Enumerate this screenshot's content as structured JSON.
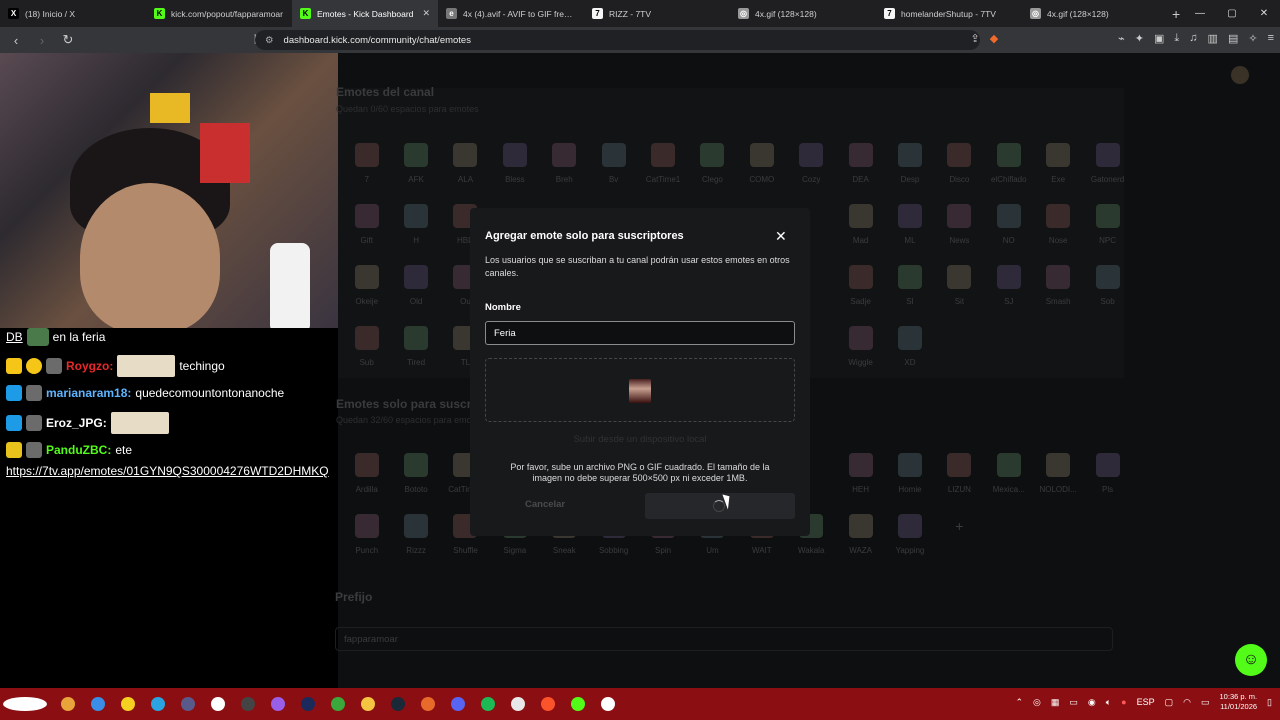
{
  "browser": {
    "tabs": [
      {
        "label": "(18) Inicio / X",
        "icon": "x-icon",
        "color": "#000000",
        "glyph": "X"
      },
      {
        "label": "kick.com/popout/fapparamoar",
        "icon": "kick-icon",
        "color": "#53fc18",
        "glyph": "K"
      },
      {
        "label": "Emotes - Kick Dashboard",
        "icon": "kick-icon",
        "color": "#53fc18",
        "glyph": "K",
        "active": true
      },
      {
        "label": "4x (4).avif - AVIF to GIF free on",
        "icon": "ezgif-icon",
        "color": "#777777",
        "glyph": "e"
      },
      {
        "label": "RIZZ - 7TV",
        "icon": "7tv-icon",
        "color": "#f5f5f5",
        "glyph": "7"
      },
      {
        "label": "4x.gif (128×128)",
        "icon": "globe-icon",
        "color": "#999999",
        "glyph": "◎"
      },
      {
        "label": "homelanderShutup - 7TV",
        "icon": "7tv-icon",
        "color": "#f5f5f5",
        "glyph": "7"
      },
      {
        "label": "4x.gif (128×128)",
        "icon": "globe-icon",
        "color": "#999999",
        "glyph": "◎"
      }
    ],
    "url": "dashboard.kick.com/community/chat/emotes"
  },
  "chat": {
    "messages": [
      {
        "user": "DB",
        "text": "en la feria",
        "user_color": "#ffffff"
      },
      {
        "user": "Roygzo:",
        "text": "techingo",
        "user_color": "#e8282b"
      },
      {
        "user": "marianaram18:",
        "text": "quedecomountontonanoche",
        "user_color": "#5fb4ff"
      },
      {
        "user": "Eroz_JPG:",
        "text": "",
        "user_color": "#ffffff"
      },
      {
        "user": "PanduZBC:",
        "text": "ete",
        "user_color": "#53fc18"
      }
    ],
    "link": "https://7tv.app/emotes/01GYN9QS300004276WTD2DHMKQ"
  },
  "dashboard": {
    "channel_section_title": "Emotes del canal",
    "channel_section_sub": "Quedan 0/60 espacios para emotes",
    "channel_emotes": [
      "7",
      "AFK",
      "ALA",
      "Bless",
      "Breh",
      "Bv",
      "CatTime1",
      "Clego",
      "COMO",
      "Cozy",
      "DEA",
      "Desp",
      "Disco",
      "elChiflado",
      "Exe",
      "Gatonerd",
      "Gift",
      "H",
      "HBD",
      "",
      "",
      "",
      "",
      "",
      "",
      "",
      "Mad",
      "ML",
      "News",
      "NO",
      "Nose",
      "NPC",
      "Okeije",
      "Old",
      "Ou",
      "",
      "",
      "",
      "",
      "",
      "",
      "",
      "Sadje",
      "SI",
      "Sit",
      "SJ",
      "Smash",
      "Sob",
      "Sub",
      "Tired",
      "TL",
      "",
      "",
      "",
      "",
      "",
      "",
      "",
      "Wiggle",
      "XD",
      "",
      "",
      "",
      ""
    ],
    "sub_section_title": "Emotes solo para suscriptores",
    "sub_section_sub": "Quedan 32/60 espacios para emotes",
    "sub_emotes": [
      "Ardilla",
      "Bototo",
      "CatTime3",
      "",
      "",
      "",
      "",
      "",
      "",
      "",
      "HEH",
      "Homie",
      "LIZUN",
      "Mexica...",
      "NOLODI...",
      "Pls",
      "Punch",
      "Rizzz",
      "Shuffle",
      "Sigma",
      "Sneak",
      "Sobbing",
      "Spin",
      "Um",
      "WAIT",
      "Wakala",
      "WAZA",
      "Yapping",
      "+",
      "",
      "",
      ""
    ],
    "prefix_title": "Prefijo",
    "prefix_value": "fapparamoar"
  },
  "modal": {
    "title": "Agregar emote solo para suscriptores",
    "description": "Los usuarios que se suscriban a tu canal podrán usar estos emotes en otros canales.",
    "name_label": "Nombre",
    "name_value": "Feria",
    "upload_label": "Subir desde un dispositivo local",
    "hint": "Por favor, sube un archivo PNG o GIF cuadrado. El tamaño de la imagen no debe superar 500×500 px ni exceder 1MB.",
    "cancel_label": "Cancelar",
    "close_glyph": "✕"
  },
  "taskbar": {
    "lang": "ESP",
    "time": "10:36 p. m.",
    "date": "11/01/2026"
  },
  "colors": {
    "kick_green": "#53fc18",
    "taskbar_red": "#8b0f12"
  }
}
